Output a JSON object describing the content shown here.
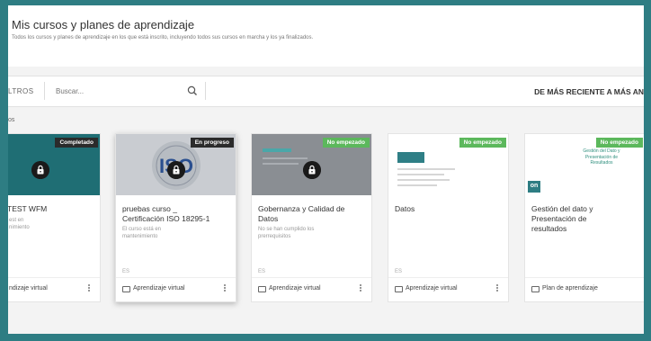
{
  "header": {
    "title": "Mis cursos y planes de aprendizaje",
    "subtitle": "Todos los cursos y planes de aprendizaje en los que está inscrito, incluyendo todos sus cursos en marcha y los ya finalizados."
  },
  "toolbar": {
    "filters_label": "LTROS",
    "search_placeholder": "Buscar...",
    "sort_label": "DE MÁS RECIENTE A MÁS AN"
  },
  "section_label": "os",
  "cards": [
    {
      "badge": "Completado",
      "badge_color": "#2b2b2b",
      "thumb_color": "#1f6e74",
      "title": "TEST WFM",
      "description": "est en\nnimiento",
      "language": "",
      "type_label": "ndizaje virtual"
    },
    {
      "badge": "En progreso",
      "badge_color": "#2b2b2b",
      "thumb_color": "#c9ccd1",
      "thumb_logo": "ISO",
      "title": "pruebas curso _\nCertificación ISO 18295-1",
      "description": "El curso está en\nmantenimiento",
      "language": "ES",
      "type_label": "Aprendizaje virtual"
    },
    {
      "badge": "No empezado",
      "badge_color": "#5cb85c",
      "thumb_color": "#8a8e93",
      "title": "Gobernanza y Calidad de\nDatos",
      "description": "No se han cumplido los\nprerrequisitos",
      "language": "ES",
      "type_label": "Aprendizaje virtual"
    },
    {
      "badge": "No empezado",
      "badge_color": "#5cb85c",
      "thumb_color": "#ffffff",
      "title": "Datos",
      "description": "",
      "language": "ES",
      "type_label": "Aprendizaje virtual"
    },
    {
      "badge": "No empezado",
      "badge_color": "#5cb85c",
      "thumb_color": "#ffffff",
      "thumb_text": "Gestión del Dato y\nPresentación de\nResultados",
      "thumb_logo": "on",
      "title": "Gestión del dato y\nPresentación de\nresultados",
      "description": "",
      "language": "",
      "type_label": "Plan de aprendizaje"
    }
  ]
}
